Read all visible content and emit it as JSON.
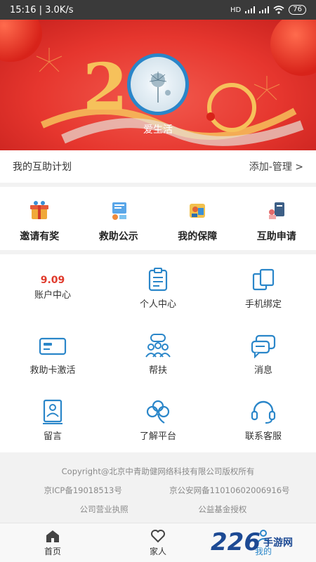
{
  "status_bar": {
    "time": "15:16",
    "speed": "3.0K/s",
    "signal": "HD",
    "battery": "76"
  },
  "banner": {
    "year_left": "2",
    "year_right": "0",
    "user_name": "爱生活"
  },
  "plan": {
    "title": "我的互助计划",
    "action": "添加-管理 >"
  },
  "quick_actions": [
    {
      "label": "邀请有奖",
      "icon": "gift-icon"
    },
    {
      "label": "救助公示",
      "icon": "announcement-icon"
    },
    {
      "label": "我的保障",
      "icon": "shield-icon"
    },
    {
      "label": "互助申请",
      "icon": "apply-icon"
    }
  ],
  "grid": {
    "account_value": "9.09",
    "items": [
      {
        "label": "账户中心",
        "icon": "wallet-icon"
      },
      {
        "label": "个人中心",
        "icon": "clipboard-icon"
      },
      {
        "label": "手机绑定",
        "icon": "link-icon"
      },
      {
        "label": "救助卡激活",
        "icon": "card-icon"
      },
      {
        "label": "帮扶",
        "icon": "people-icon"
      },
      {
        "label": "消息",
        "icon": "message-icon"
      },
      {
        "label": "留言",
        "icon": "note-icon"
      },
      {
        "label": "了解平台",
        "icon": "clover-icon"
      },
      {
        "label": "联系客服",
        "icon": "headset-icon"
      }
    ]
  },
  "footer": {
    "copyright": "Copyright@北京中青助健网络科技有限公司版权所有",
    "icp": "京ICP备19018513号",
    "police": "京公安网备11010602006916号",
    "license": "公司营业执照",
    "fund": "公益基金授权"
  },
  "tabs": [
    {
      "label": "首页",
      "icon": "home-icon"
    },
    {
      "label": "家人",
      "icon": "heart-icon"
    },
    {
      "label": "我的",
      "icon": "user-icon"
    }
  ],
  "watermark": {
    "number": "226",
    "text": "手游网"
  },
  "colors": {
    "accent": "#2a86c9",
    "banner_red": "#e6362e",
    "gold": "#f6c15b",
    "value_red": "#e03a2c"
  }
}
